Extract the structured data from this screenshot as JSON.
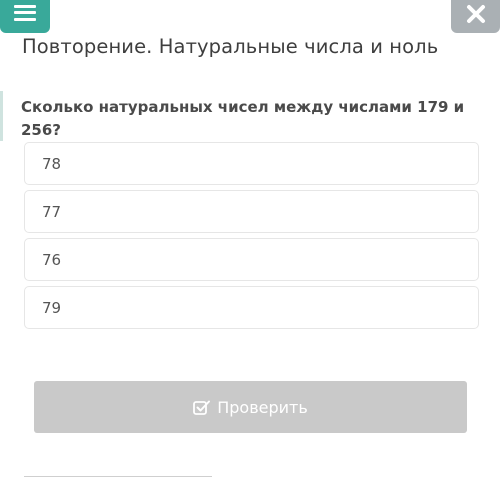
{
  "header": {
    "menu_icon": "hamburger-menu-icon",
    "close_icon": "close-icon",
    "menu_color": "#39a99a",
    "close_color": "#aab0b4"
  },
  "lesson": {
    "title": "Повторение. Натуральные числа и ноль"
  },
  "question": {
    "text": "Сколько натуральных чисел между числами 179 и 256?",
    "options": [
      "78",
      "77",
      "76",
      "79"
    ]
  },
  "actions": {
    "check_label": "Проверить",
    "check_icon": "checkbox-icon",
    "check_color": "#c9c9c9"
  }
}
